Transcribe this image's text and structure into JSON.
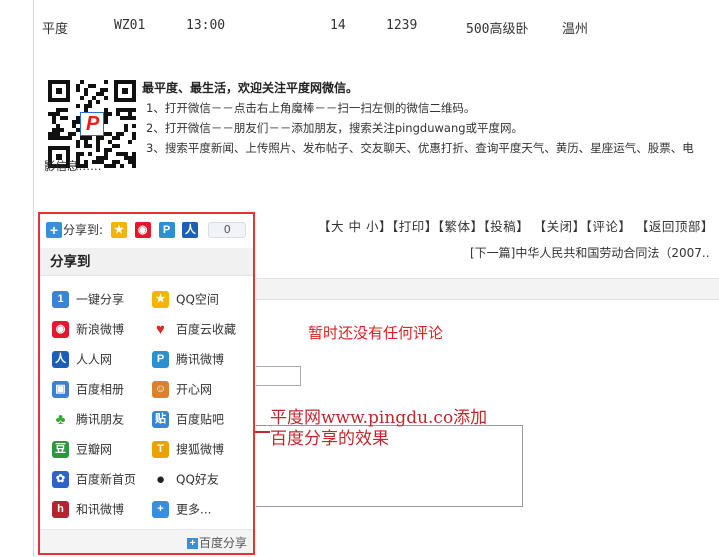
{
  "train_row": {
    "from": "平度",
    "train_no": "WZ01",
    "time": "13:00",
    "count": "14",
    "distance": "1239",
    "berth": "500高级卧",
    "to": "温州"
  },
  "wechat": {
    "title": "最平度、最生活，欢迎关注平度网微信。",
    "step1": "1、打开微信－－点击右上角魔棒－－扫一扫左侧的微信二维码。",
    "step2": "2、打开微信－－朋友们－－添加朋友，搜索关注pingduwang或平度网。",
    "step3": "3、搜索平度新闻、上传照片、发布帖子、交友聊天、优惠打折、查询平度天气、黄历、星座运气、股票、电",
    "step3_cont": "影信息……"
  },
  "toolbar": {
    "text": "【大 中 小】【打印】【繁体】【投稿】 【关闭】【评论】 【返回顶部】"
  },
  "next_article": "[下一篇]中华人民共和国劳动合同法（2007..",
  "comments": {
    "empty_text": "暂时还没有任何评论"
  },
  "annotation": {
    "line1": "平度网www.pingdu.co添加",
    "line2": "百度分享的效果"
  },
  "share": {
    "top_label": "分享到:",
    "count": "0",
    "header": "分享到",
    "items": [
      {
        "label": "一键分享",
        "icon": "one-click-icon",
        "color": "#3b83d6",
        "glyph": "1"
      },
      {
        "label": "QQ空间",
        "icon": "qzone-icon",
        "color": "#f5b400",
        "glyph": "★"
      },
      {
        "label": "新浪微博",
        "icon": "sina-weibo-icon",
        "color": "#e6162d",
        "glyph": "◉"
      },
      {
        "label": "百度云收藏",
        "icon": "heart-icon",
        "color": "#ffffff",
        "glyph": "♥"
      },
      {
        "label": "人人网",
        "icon": "renren-icon",
        "color": "#1c5fb4",
        "glyph": "人"
      },
      {
        "label": "腾讯微博",
        "icon": "tencent-weibo-icon",
        "color": "#2b8fd0",
        "glyph": "P"
      },
      {
        "label": "百度相册",
        "icon": "baidu-album-icon",
        "color": "#3a80d8",
        "glyph": "▣"
      },
      {
        "label": "开心网",
        "icon": "kaixin-icon",
        "color": "#d9822b",
        "glyph": "☺"
      },
      {
        "label": "腾讯朋友",
        "icon": "clover-icon",
        "color": "#ffffff",
        "glyph": "♣"
      },
      {
        "label": "百度贴吧",
        "icon": "tieba-icon",
        "color": "#3b83d6",
        "glyph": "贴"
      },
      {
        "label": "豆瓣网",
        "icon": "douban-icon",
        "color": "#2e963d",
        "glyph": "豆"
      },
      {
        "label": "搜狐微博",
        "icon": "sohu-icon",
        "color": "#e8a300",
        "glyph": "T"
      },
      {
        "label": "百度新首页",
        "icon": "baidu-paw-icon",
        "color": "#2d63c8",
        "glyph": "✿"
      },
      {
        "label": "QQ好友",
        "icon": "qq-penguin-icon",
        "color": "#ffffff",
        "glyph": "●"
      },
      {
        "label": "和讯微博",
        "icon": "hexun-icon",
        "color": "#b5232e",
        "glyph": "h"
      },
      {
        "label": "更多...",
        "icon": "more-plus-icon",
        "color": "#3a8fdc",
        "glyph": "+"
      }
    ],
    "footer_brand": "百度分享"
  },
  "colors": {
    "annotation_red": "#c0282d",
    "panel_border": "#e53333",
    "empty_comment": "#dd2222"
  }
}
